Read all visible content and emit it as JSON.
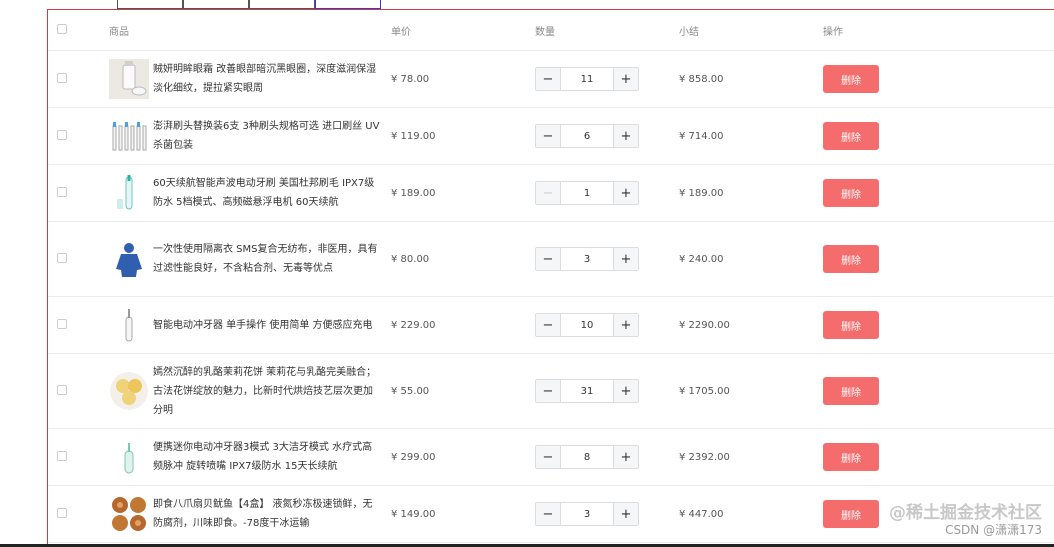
{
  "header": {
    "product": "商品",
    "price": "单价",
    "quantity": "数量",
    "subtotal": "小结",
    "actions": "操作"
  },
  "stepper": {
    "minus": "−",
    "plus": "+"
  },
  "delete_label": "删除",
  "colors": {
    "delete": "#f56c6c",
    "frame": "#d03b3b"
  },
  "rows": [
    {
      "name": "贼妍明眸眼霜 改善眼部暗沉黑眼圈，深度滋润保湿淡化细纹，提拉紧实眼周",
      "price": "¥ 78.00",
      "qty": "11",
      "subtotal": "¥ 858.00",
      "thumb": "eye-cream-icon",
      "h": 57
    },
    {
      "name": "澎湃刷头替换装6支 3种刷头规格可选 进口刷丝 UV杀菌包装",
      "price": "¥ 119.00",
      "qty": "6",
      "subtotal": "¥ 714.00",
      "thumb": "brush-heads-icon",
      "h": 57
    },
    {
      "name": "60天续航智能声波电动牙刷 美国杜邦刷毛 IPX7级防水 5档模式、高频磁悬浮电机 60天续航",
      "price": "¥ 189.00",
      "qty": "1",
      "subtotal": "¥ 189.00",
      "thumb": "toothbrush-icon",
      "h": 57
    },
    {
      "name": "一次性使用隔离衣 SMS复合无纺布，非医用，具有过滤性能良好，不含粘合剂、无毒等优点",
      "price": "¥ 80.00",
      "qty": "3",
      "subtotal": "¥ 240.00",
      "thumb": "isolation-gown-icon",
      "h": 75
    },
    {
      "name": "智能电动冲牙器 单手操作 使用简单 方便感应充电",
      "price": "¥ 229.00",
      "qty": "10",
      "subtotal": "¥ 2290.00",
      "thumb": "water-flosser-icon",
      "h": 57
    },
    {
      "name": "嫣然沉醉的乳酪茉莉花饼 茉莉花与乳酪完美融合；古法花饼绽放的魅力，比新时代烘焙技艺层次更加分明",
      "price": "¥ 55.00",
      "qty": "31",
      "subtotal": "¥ 1705.00",
      "thumb": "flower-cake-icon",
      "h": 75
    },
    {
      "name": "便携迷你电动冲牙器3模式 3大洁牙模式 水疗式高频脉冲 旋转喷嘴 IPX7级防水 15天长续航",
      "price": "¥ 299.00",
      "qty": "8",
      "subtotal": "¥ 2392.00",
      "thumb": "mini-flosser-icon",
      "h": 57
    },
    {
      "name": "即食八爪扇贝鱿鱼【4盒】 液氮秒冻极速锁鲜，无防腐剂，川味即食。-78度干冰运输",
      "price": "¥ 149.00",
      "qty": "3",
      "subtotal": "¥ 447.00",
      "thumb": "scallop-icon",
      "h": 57
    }
  ],
  "watermark": {
    "line1": "@稀土掘金技术社区",
    "line2": "CSDN @潇潇173"
  }
}
